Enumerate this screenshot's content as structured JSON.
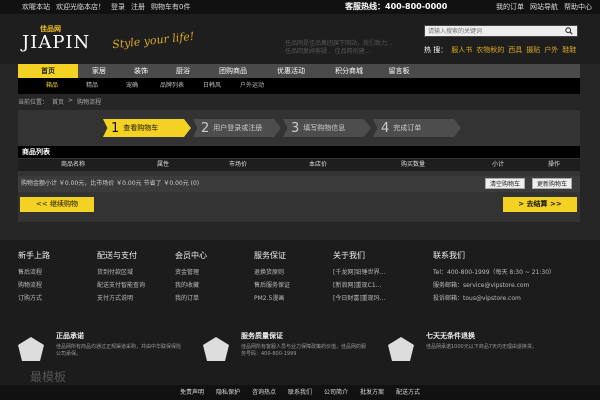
{
  "topbar": {
    "welcome": "欢喔本站",
    "hello": "欢迎光临本店！",
    "login": "登录",
    "register": "注册",
    "cart": "购物车有0件",
    "hotline": "客服热线：400-800-0000",
    "my_order": "我的订单",
    "site_nav": "网站导航",
    "help": "帮助中心"
  },
  "header": {
    "logo": "JIAPIN",
    "logo_cn": "佳品网",
    "slogan": "Style your life!",
    "notice": "任品网是佳品集团旗下网站，我们致力... 任品回复顾客疑... 佳品网创建..."
  },
  "search": {
    "placeholder": "请输入搜索的关键词"
  },
  "hot": {
    "label": "热  搜：",
    "items": [
      "服人书",
      "农物秋的",
      "西具",
      "摄贴",
      "户外",
      "鞋鞋"
    ]
  },
  "nav": {
    "items": [
      "首页",
      "家居",
      "装饰",
      "厨浴",
      "团购商品",
      "优惠活动",
      "积分商城",
      "留言板"
    ]
  },
  "subnav": {
    "items": [
      "箱品",
      "精品",
      "宠确",
      "品牌列表",
      "日韩风",
      "户外运动"
    ]
  },
  "breadcrumb": {
    "label": "当前位置：",
    "home": "首页",
    "current": "购物流程"
  },
  "steps": [
    {
      "num": "1",
      "label": "查看购物车"
    },
    {
      "num": "2",
      "label": "用户登录或注册"
    },
    {
      "num": "3",
      "label": "填写购物信息"
    },
    {
      "num": "4",
      "label": "完成订单"
    }
  ],
  "list": {
    "title": "商品列表",
    "columns": [
      "商品名称",
      "属性",
      "市场价",
      "本店价",
      "购买数量",
      "小计",
      "操作"
    ],
    "summary": "购物金额小计 ￥0.00元，比市场价 ￥0.00元 节省了 ￥0.00元 (0)",
    "clear": "清空购物车",
    "update": "更新购物车",
    "back": "<< 继续购物",
    "checkout": "> 去结算 >>"
  },
  "footer": {
    "cols": [
      {
        "title": "新手上路",
        "items": [
          "售后流程",
          "购物流程",
          "订购方式"
        ]
      },
      {
        "title": "配送与支付",
        "items": [
          "货到付款区域",
          "配送支付智能查询",
          "支付方式说明"
        ]
      },
      {
        "title": "会员中心",
        "items": [
          "资金管理",
          "我的收藏",
          "我的订单"
        ]
      },
      {
        "title": "服务保证",
        "items": [
          "退换货原则",
          "售后服务保证",
          "PM2.5漫画"
        ]
      },
      {
        "title": "关于我们",
        "items": [
          "[千龙网]铅锤世界...",
          "[新浪网]重现C1...",
          "[今日财富]重现玛..."
        ]
      },
      {
        "title": "联系我们",
        "items": [
          "Tel：400-800-1999（每天 8:30 ~ 21:30）",
          "服务邮箱：service@vipstore.com",
          "投诉邮箱：tous@vipstore.com"
        ]
      }
    ],
    "badges": [
      {
        "icon": "正品",
        "title": "正品承诺",
        "desc": "佳品网所有商品均通过正规渠道采购，并由中华联保保险公司承保。"
      },
      {
        "icon": "服务",
        "title": "服务质量保证",
        "desc": "佳品网所有客服人员与业力保障政策的价值，佳品网的服务号码：400-800-1999"
      },
      {
        "icon": "七天",
        "title": "七天无条件退换",
        "desc": "佳品网承诺1000元以下商品7天内无理由退换货。"
      }
    ],
    "watermark": "最模板",
    "bottom_links": [
      "免责声明",
      "隐私保护",
      "咨询热点",
      "联系我们",
      "公司简介",
      "批发方案",
      "配送方式"
    ]
  }
}
